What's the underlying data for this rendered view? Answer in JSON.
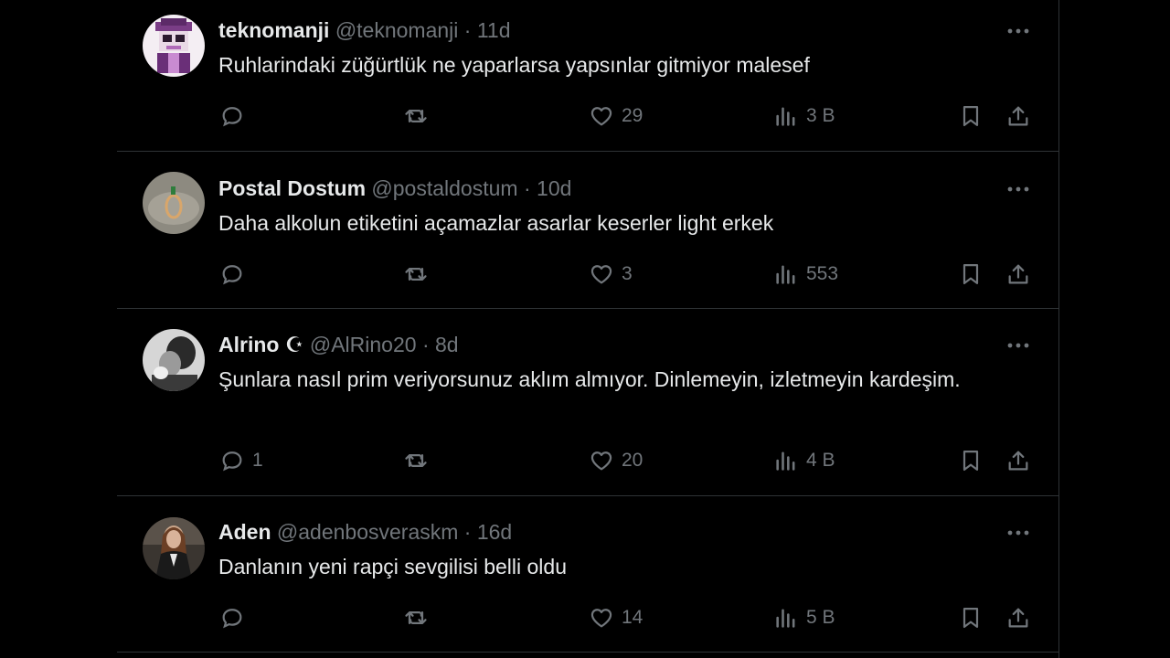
{
  "tweets": [
    {
      "name": "teknomanji",
      "badge": "",
      "handle": "@teknomanji",
      "sep": "·",
      "time": "11d",
      "text": "Ruhlarindaki züğürtlük ne yaparlarsa yapsınlar gitmiyor malesef",
      "replies": "",
      "retweets": "",
      "likes": "29",
      "views": "3 B",
      "avatar": "pixel-art-character-avatar"
    },
    {
      "name": "Postal Dostum",
      "badge": "",
      "handle": "@postaldostum",
      "sep": "·",
      "time": "10d",
      "text": "Daha alkolun etiketini açamazlar asarlar keserler light erkek",
      "replies": "",
      "retweets": "",
      "likes": "3",
      "views": "553",
      "avatar": "ring-photo-avatar"
    },
    {
      "name": "Alrino",
      "badge": "☪",
      "handle": "@AlRino20",
      "sep": "·",
      "time": "8d",
      "text": "Şunlara nasıl prim veriyorsunuz aklım almıyor. Dinlemeyin, izletmeyin kardeşim.",
      "replies": "1",
      "retweets": "",
      "likes": "20",
      "views": "4 B",
      "avatar": "person-photo-avatar"
    },
    {
      "name": "Aden",
      "badge": "",
      "handle": "@adenbosveraskm",
      "sep": "·",
      "time": "16d",
      "text": "Danlanın yeni rapçi sevgilisi belli oldu",
      "replies": "",
      "retweets": "",
      "likes": "14",
      "views": "5 B",
      "avatar": "woman-photo-avatar"
    }
  ],
  "colors": {
    "background": "#000000",
    "text": "#e7e9ea",
    "secondary": "#71767b",
    "border": "#2f3336"
  }
}
